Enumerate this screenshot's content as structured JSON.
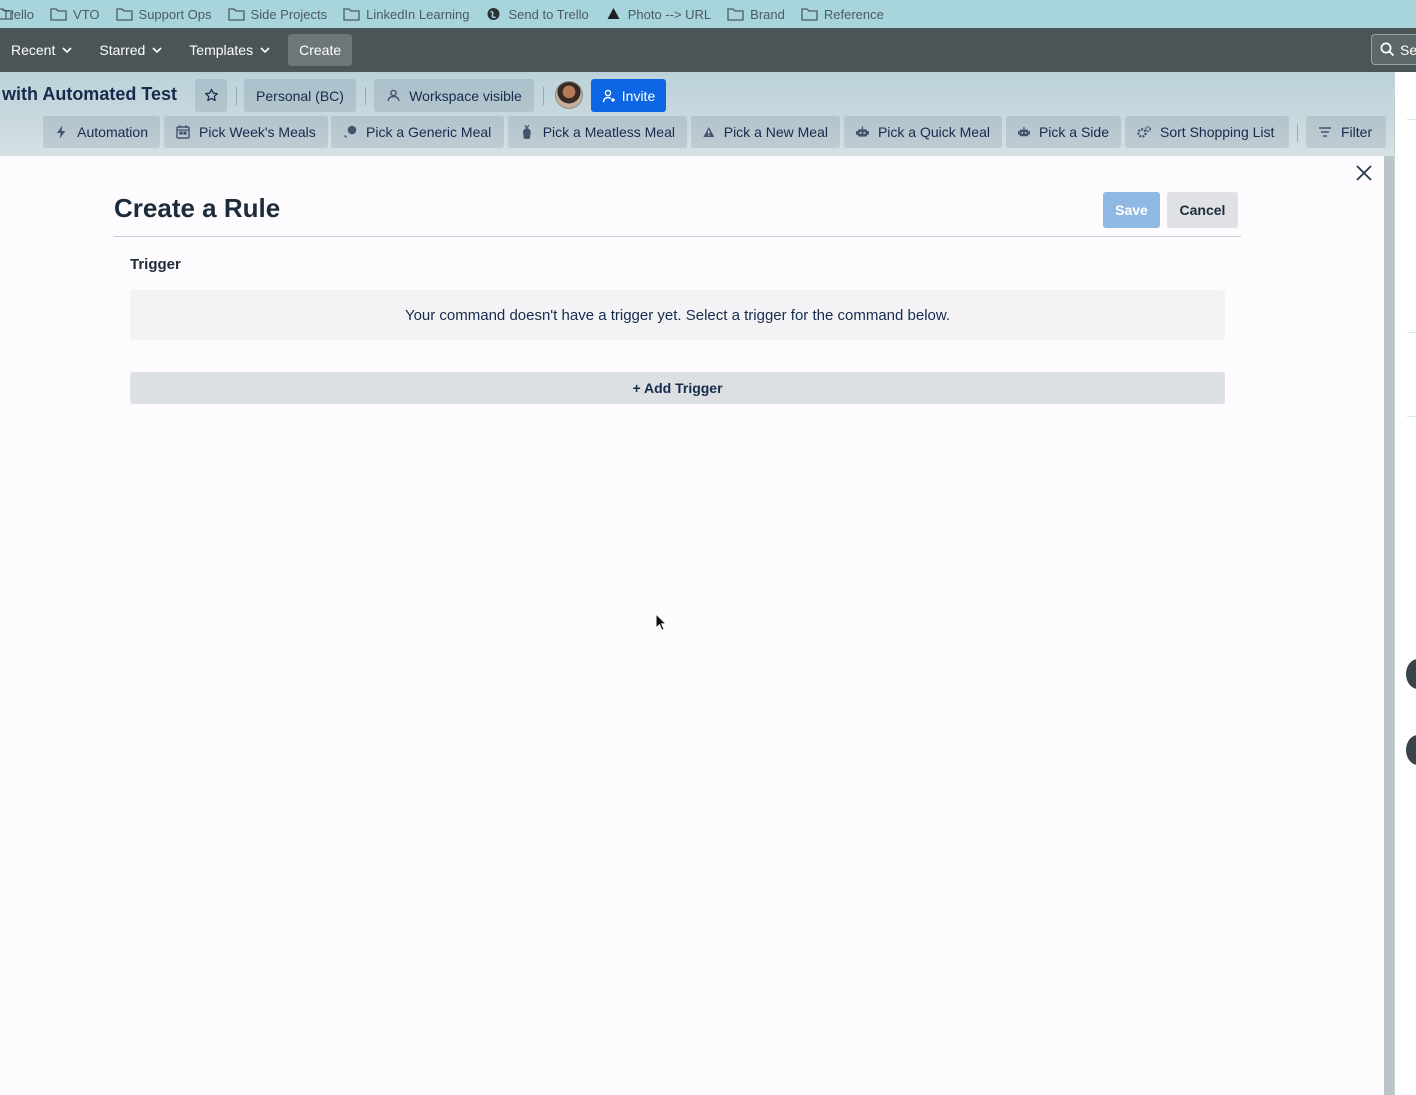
{
  "bookmarks": [
    {
      "label": "Trello",
      "icon": "folder-icon"
    },
    {
      "label": "VTO",
      "icon": "folder-icon"
    },
    {
      "label": "Support Ops",
      "icon": "folder-icon"
    },
    {
      "label": "Side Projects",
      "icon": "folder-icon"
    },
    {
      "label": "LinkedIn Learning",
      "icon": "folder-icon"
    },
    {
      "label": "Send to Trello",
      "icon": "globe-icon"
    },
    {
      "label": "Photo --> URL",
      "icon": "drive-triangle-icon"
    },
    {
      "label": "Brand",
      "icon": "folder-icon"
    },
    {
      "label": "Reference",
      "icon": "folder-icon"
    }
  ],
  "nav": {
    "recent": "Recent",
    "starred": "Starred",
    "templates": "Templates",
    "create": "Create",
    "search_placeholder": "Se"
  },
  "board": {
    "title": "with Automated Test",
    "workspace": "Personal (BC)",
    "visibility": "Workspace visible",
    "invite": "Invite",
    "automation": "Automation",
    "filter": "Filter",
    "commands": [
      "Pick Week's Meals",
      "Pick a Generic Meal",
      "Pick a Meatless Meal",
      "Pick a New Meal",
      "Pick a Quick Meal",
      "Pick a Side",
      "Sort Shopping List"
    ]
  },
  "modal": {
    "title": "Create a Rule",
    "save": "Save",
    "cancel": "Cancel",
    "trigger_heading": "Trigger",
    "notice": "Your command doesn't have a trigger yet. Select a trigger for the command below.",
    "add_trigger": "+ Add Trigger"
  },
  "colors": {
    "bookmarks_bg": "#a8d5dc",
    "nav_bg": "#4b5557",
    "invite_blue": "#0c66e4",
    "save_disabled": "#8fb8e2"
  }
}
